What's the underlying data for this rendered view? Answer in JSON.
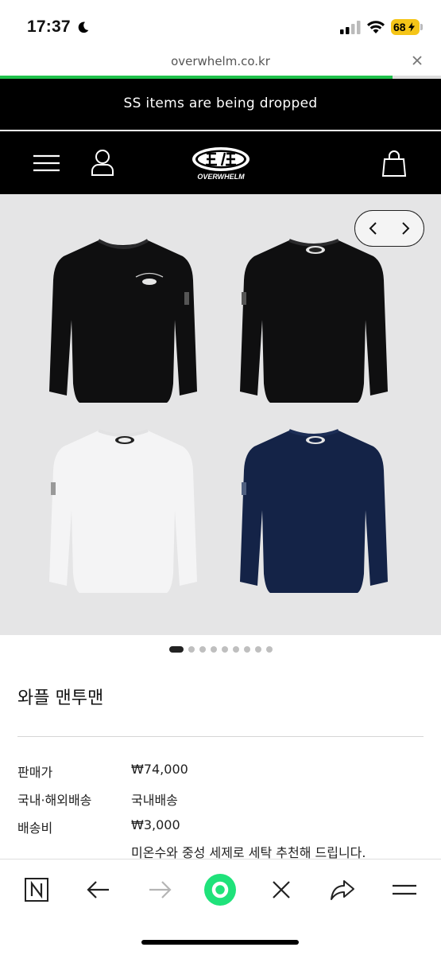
{
  "status_bar": {
    "time": "17:37",
    "battery": "68",
    "icons": [
      "moon-icon",
      "signal-icon",
      "wifi-icon",
      "battery-icon"
    ]
  },
  "browser": {
    "url": "overwhelm.co.kr",
    "load_progress": 0.89,
    "toolbar": [
      "n-home-icon",
      "back-arrow-icon",
      "forward-arrow-icon",
      "green-circle-button",
      "close-icon",
      "share-icon",
      "menu-icon"
    ]
  },
  "announcement": {
    "text": "SS items are being dropped"
  },
  "header": {
    "logo_text": "OVERWHELM",
    "icons": [
      "hamburger-menu-icon",
      "user-icon",
      "shopping-bag-icon"
    ]
  },
  "gallery": {
    "background": "#e5e5e6",
    "items": [
      {
        "color": "#0f0f10",
        "view": "front-chest-logo"
      },
      {
        "color": "#0f0f10",
        "view": "back-neck-logo"
      },
      {
        "color": "#f4f4f5",
        "view": "back-neck-logo"
      },
      {
        "color": "#142347",
        "view": "back-neck-logo"
      }
    ],
    "dot_count": 9,
    "active_dot": 0
  },
  "product": {
    "title": "와플 맨투맨",
    "info": [
      {
        "label": "판매가",
        "value": "₩74,000"
      },
      {
        "label": "국내·해외배송",
        "value": "국내배송"
      },
      {
        "label": "배송비",
        "value": "₩3,000"
      }
    ],
    "note": "미온수와 중성 세제로 세탁 추천해 드립니다."
  },
  "colors": {
    "accent_green": "#1fc14a",
    "header_black": "#000000",
    "battery_yellow": "#f5c518"
  }
}
